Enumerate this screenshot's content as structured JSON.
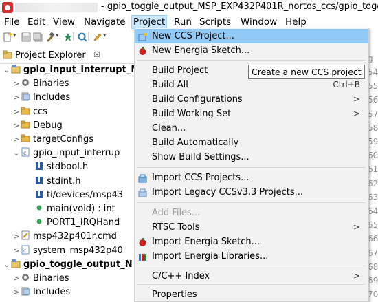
{
  "window": {
    "title": "- gpio_toggle_output_MSP_EXP432P401R_nortos_ccs/gpio_toggle"
  },
  "menubar": {
    "items": [
      "File",
      "Edit",
      "View",
      "Navigate",
      "Project",
      "Run",
      "Scripts",
      "Window",
      "Help"
    ],
    "active": "Project"
  },
  "project_explorer": {
    "title": "Project Explorer",
    "close_symbol": "☒",
    "tree": [
      {
        "label": "gpio_input_interrupt_M",
        "bold": true,
        "icon": "project-icon",
        "twisty": "⌄"
      },
      {
        "label": "Binaries",
        "icon": "binaries-icon",
        "twisty": ">"
      },
      {
        "label": "Includes",
        "icon": "includes-icon",
        "twisty": ">"
      },
      {
        "label": "ccs",
        "icon": "folder-icon",
        "twisty": ">"
      },
      {
        "label": "Debug",
        "icon": "folder-icon",
        "twisty": ">"
      },
      {
        "label": "targetConfigs",
        "icon": "folder-icon",
        "twisty": ">"
      },
      {
        "label": "gpio_input_interrup",
        "icon": "c-file-icon",
        "twisty": "⌄"
      },
      {
        "label": "stdbool.h",
        "icon": "include-header-icon",
        "twisty": ""
      },
      {
        "label": "stdint.h",
        "icon": "include-header-icon",
        "twisty": ""
      },
      {
        "label": "ti/devices/msp43",
        "icon": "include-header-icon",
        "twisty": ""
      },
      {
        "label": "main(void) : int",
        "icon": "function-dot-icon",
        "twisty": ""
      },
      {
        "label": "PORT1_IRQHand",
        "icon": "function-dot-icon",
        "twisty": ""
      },
      {
        "label": "msp432p401r.cmd",
        "icon": "cmd-file-icon",
        "twisty": ">"
      },
      {
        "label": "system_msp432p40",
        "icon": "c-file-icon",
        "twisty": ">"
      },
      {
        "label": "gpio_toggle_output_N",
        "bold": true,
        "icon": "project-icon",
        "twisty": "⌄"
      },
      {
        "label": "Binaries",
        "icon": "binaries-icon",
        "twisty": ">"
      },
      {
        "label": "Includes",
        "icon": "includes-icon",
        "twisty": ">"
      }
    ]
  },
  "dropdown": {
    "items": [
      {
        "label": "New CCS Project...",
        "icon": "new-ccs-project-icon",
        "highlighted": true
      },
      {
        "label": "New Energia Sketch...",
        "icon": "energia-icon"
      },
      {
        "label": "Build Project"
      },
      {
        "label": "Build All",
        "shortcut": "Ctrl+B"
      },
      {
        "label": "Build Configurations",
        "submenu": true
      },
      {
        "label": "Build Working Set",
        "submenu": true
      },
      {
        "label": "Clean..."
      },
      {
        "label": "Build Automatically"
      },
      {
        "label": "Show Build Settings..."
      },
      {
        "label": "Import CCS Projects...",
        "icon": "import-icon"
      },
      {
        "label": "Import Legacy CCSv3.3 Projects...",
        "icon": "import-legacy-icon"
      },
      {
        "label": "Add Files...",
        "disabled": true
      },
      {
        "label": "RTSC Tools",
        "submenu": true
      },
      {
        "label": "Import Energia Sketch...",
        "icon": "energia-icon"
      },
      {
        "label": "Import Energia Libraries...",
        "icon": "library-icon"
      },
      {
        "label": "C/C++ Index",
        "submenu": true
      },
      {
        "label": "Properties"
      }
    ],
    "submenu_arrow": ">"
  },
  "tooltip": {
    "text": "Create a new CCS project"
  },
  "editor": {
    "tab_fragment": "g",
    "line_numbers": [
      "54",
      "55",
      "56",
      "57",
      "58",
      "59",
      "60",
      "61",
      "62",
      "63",
      "64",
      "65",
      "66",
      "67",
      "68",
      "69",
      "70"
    ]
  },
  "colors": {
    "menu_highlight": "#91c9f7",
    "menubar_active": "#cce8ff",
    "menu_bg": "#f2f2f2",
    "energia_red": "#cc1f1f"
  }
}
